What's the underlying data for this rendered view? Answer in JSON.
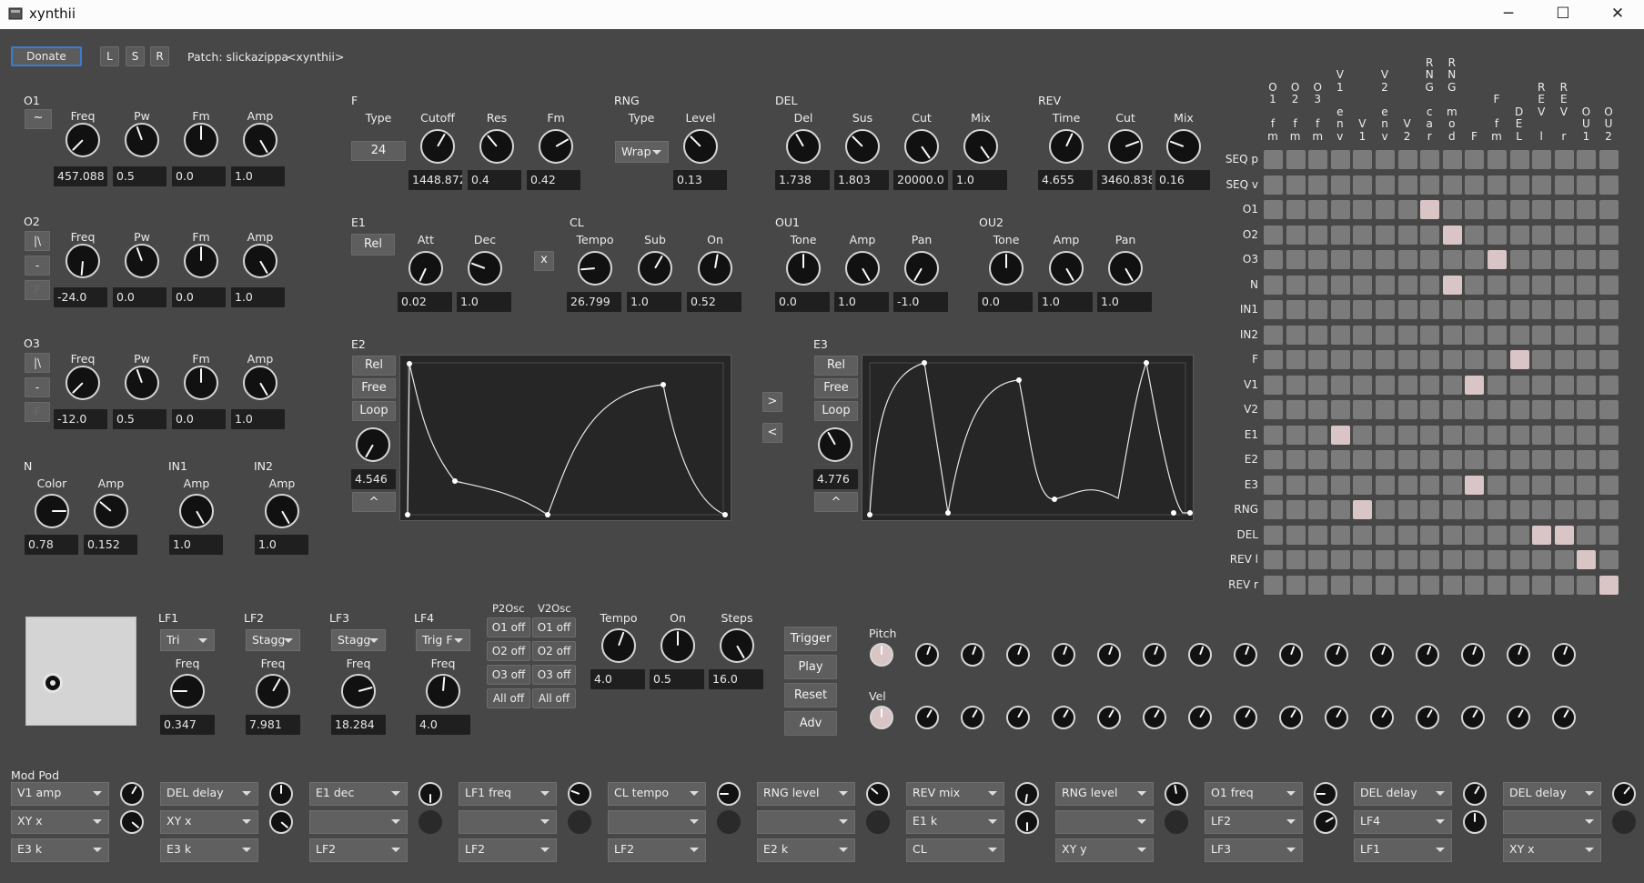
{
  "window": {
    "title": "xynthii",
    "minimize_icon": "minimize-icon",
    "maximize_icon": "maximize-icon",
    "close_icon": "close-icon"
  },
  "toolbar": {
    "donate": "Donate",
    "load": "L",
    "save": "S",
    "random": "R",
    "patch_label": "Patch: slickazippa",
    "patch_author": "<xynthii>"
  },
  "o1": {
    "name": "O1",
    "wave_icon": "~",
    "knobs": [
      {
        "label": "Freq",
        "value": "457.088"
      },
      {
        "label": "Pw",
        "value": "0.5"
      },
      {
        "label": "Fm",
        "value": "0.0"
      },
      {
        "label": "Amp",
        "value": "1.0"
      }
    ]
  },
  "o2": {
    "name": "O2",
    "wave_buttons": [
      "|\\",
      "-",
      "F"
    ],
    "knobs": [
      {
        "label": "Freq",
        "value": "-24.0"
      },
      {
        "label": "Pw",
        "value": "0.0"
      },
      {
        "label": "Fm",
        "value": "0.0"
      },
      {
        "label": "Amp",
        "value": "1.0"
      }
    ]
  },
  "o3": {
    "name": "O3",
    "wave_buttons": [
      "|\\",
      "-",
      "F"
    ],
    "knobs": [
      {
        "label": "Freq",
        "value": "-12.0"
      },
      {
        "label": "Pw",
        "value": "0.5"
      },
      {
        "label": "Fm",
        "value": "0.0"
      },
      {
        "label": "Amp",
        "value": "1.0"
      }
    ]
  },
  "noise": {
    "name": "N",
    "knobs": [
      {
        "label": "Color",
        "value": "0.78"
      },
      {
        "label": "Amp",
        "value": "0.152"
      }
    ]
  },
  "in1": {
    "name": "IN1",
    "knobs": [
      {
        "label": "Amp",
        "value": "1.0"
      }
    ]
  },
  "in2": {
    "name": "IN2",
    "knobs": [
      {
        "label": "Amp",
        "value": "1.0"
      }
    ]
  },
  "filter": {
    "name": "F",
    "type_label": "Type",
    "type_value": "24",
    "knobs": [
      {
        "label": "Cutoff",
        "value": "1448.872"
      },
      {
        "label": "Res",
        "value": "0.4"
      },
      {
        "label": "Fm",
        "value": "0.42"
      }
    ]
  },
  "rng": {
    "name": "RNG",
    "type_label": "Type",
    "type_value": "Wrap",
    "knobs": [
      {
        "label": "Level",
        "value": "0.13"
      }
    ]
  },
  "del": {
    "name": "DEL",
    "knobs": [
      {
        "label": "Del",
        "value": "1.738"
      },
      {
        "label": "Sus",
        "value": "1.803"
      },
      {
        "label": "Cut",
        "value": "20000.0"
      },
      {
        "label": "Mix",
        "value": "1.0"
      }
    ]
  },
  "rev": {
    "name": "REV",
    "knobs": [
      {
        "label": "Time",
        "value": "4.655"
      },
      {
        "label": "Cut",
        "value": "3460.838"
      },
      {
        "label": "Mix",
        "value": "0.16"
      }
    ]
  },
  "e1": {
    "name": "E1",
    "rel": "Rel",
    "knobs": [
      {
        "label": "Att",
        "value": "0.02"
      },
      {
        "label": "Dec",
        "value": "1.0"
      }
    ],
    "x_button": "x"
  },
  "cl": {
    "name": "CL",
    "knobs": [
      {
        "label": "Tempo",
        "value": "26.799"
      },
      {
        "label": "Sub",
        "value": "1.0"
      },
      {
        "label": "On",
        "value": "0.52"
      }
    ]
  },
  "ou1": {
    "name": "OU1",
    "knobs": [
      {
        "label": "Tone",
        "value": "0.0"
      },
      {
        "label": "Amp",
        "value": "1.0"
      },
      {
        "label": "Pan",
        "value": "-1.0"
      }
    ]
  },
  "ou2": {
    "name": "OU2",
    "knobs": [
      {
        "label": "Tone",
        "value": "0.0"
      },
      {
        "label": "Amp",
        "value": "1.0"
      },
      {
        "label": "Pan",
        "value": "1.0"
      }
    ]
  },
  "e2": {
    "name": "E2",
    "buttons": [
      "Rel",
      "Free",
      "Loop"
    ],
    "value": "4.546",
    "up": "^"
  },
  "e3": {
    "name": "E3",
    "buttons": [
      "Rel",
      "Free",
      "Loop"
    ],
    "value": "4.776",
    "up": "^"
  },
  "env_copy": {
    "right": ">",
    "left": "<"
  },
  "xy_pad": {
    "label": "xy-pad"
  },
  "lfos": [
    {
      "name": "LF1",
      "wave": "Tri",
      "freq_label": "Freq",
      "value": "0.347"
    },
    {
      "name": "LF2",
      "wave": "Stagg",
      "freq_label": "Freq",
      "value": "7.981"
    },
    {
      "name": "LF3",
      "wave": "Stagg",
      "freq_label": "Freq",
      "value": "18.284"
    },
    {
      "name": "LF4",
      "wave": "Trig F",
      "freq_label": "Freq",
      "value": "4.0"
    }
  ],
  "p2osc": {
    "name": "P2Osc",
    "buttons": [
      "O1 off",
      "O2 off",
      "O3 off",
      "All off"
    ]
  },
  "v2osc": {
    "name": "V2Osc",
    "buttons": [
      "O1 off",
      "O2 off",
      "O3 off",
      "All off"
    ]
  },
  "seq": {
    "knobs": [
      {
        "label": "Tempo",
        "value": "4.0"
      },
      {
        "label": "On",
        "value": "0.5"
      },
      {
        "label": "Steps",
        "value": "16.0"
      }
    ],
    "buttons": [
      "Trigger",
      "Play",
      "Reset",
      "Adv"
    ],
    "pitch_label": "Pitch",
    "vel_label": "Vel"
  },
  "matrix": {
    "columns": [
      "O\n1\n\nf\nm",
      "O\n2\n\nf\nm",
      "O\n3\n\nf\nm",
      "V\n1\n\ne\nn\nv",
      "V\n1",
      "V\n2\n\ne\nn\nv",
      "V\n2",
      "R\nN\nG\n\nc\na\nr",
      "R\nN\nG\n\nm\no\nd",
      "F",
      "F\n\nf\nm",
      "D\nE\nL",
      "R\nE\nV\n\nl",
      "R\nE\nV\n\nr",
      "O\nU\n1",
      "O\nU\n2"
    ],
    "rows": [
      "SEQ p",
      "SEQ v",
      "O1",
      "O2",
      "O3",
      "N",
      "IN1",
      "IN2",
      "F",
      "V1",
      "V2",
      "E1",
      "E2",
      "E3",
      "RNG",
      "DEL",
      "REV l",
      "REV r"
    ],
    "active": [
      [
        2,
        7
      ],
      [
        3,
        8
      ],
      [
        4,
        10
      ],
      [
        5,
        8
      ],
      [
        8,
        11
      ],
      [
        9,
        9
      ],
      [
        11,
        3
      ],
      [
        13,
        9
      ],
      [
        14,
        4
      ],
      [
        15,
        12
      ],
      [
        15,
        13
      ],
      [
        16,
        14
      ],
      [
        17,
        15
      ]
    ]
  },
  "mod_pod": {
    "title": "Mod Pod",
    "slots": [
      {
        "dest": "V1 amp",
        "src1": "XY x",
        "src2": "E3 k"
      },
      {
        "dest": "DEL delay",
        "src1": "XY x",
        "src2": "E3 k"
      },
      {
        "dest": "E1 dec",
        "src1": "",
        "src2": "LF2"
      },
      {
        "dest": "LF1 freq",
        "src1": "",
        "src2": "LF2"
      },
      {
        "dest": "CL tempo",
        "src1": "",
        "src2": "LF2"
      },
      {
        "dest": "RNG level",
        "src1": "",
        "src2": "E2 k"
      },
      {
        "dest": "REV mix",
        "src1": "E1 k",
        "src2": "CL"
      },
      {
        "dest": "RNG level",
        "src1": "",
        "src2": "XY y"
      },
      {
        "dest": "O1 freq",
        "src1": "LF2",
        "src2": "LF3"
      },
      {
        "dest": "DEL delay",
        "src1": "LF4",
        "src2": "LF1"
      },
      {
        "dest": "DEL delay",
        "src1": "",
        "src2": "XY x"
      }
    ]
  },
  "colors": {
    "bg": "#474747",
    "knob": "#111111",
    "knob_ring": "#d6d6d6",
    "cell": "#7b7b7b",
    "cell_on": "#d9c4c6",
    "donate_border": "#3b7bd4"
  }
}
